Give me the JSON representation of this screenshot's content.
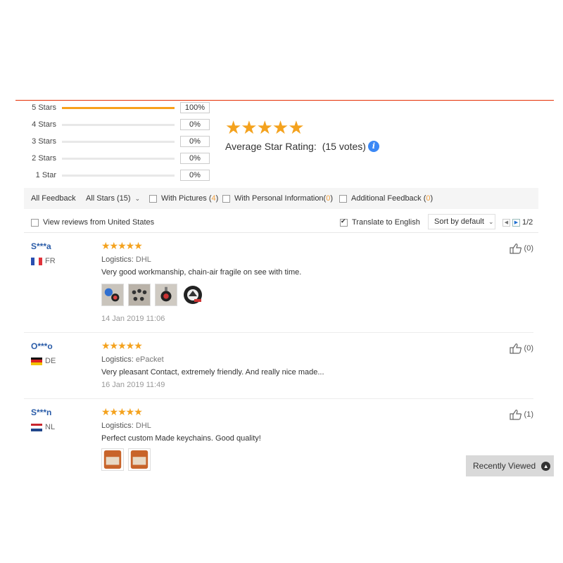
{
  "histogram": [
    {
      "label": "5 Stars",
      "percent": "100%",
      "fill": 1.0
    },
    {
      "label": "4 Stars",
      "percent": "0%",
      "fill": 0
    },
    {
      "label": "3 Stars",
      "percent": "0%",
      "fill": 0
    },
    {
      "label": "2 Stars",
      "percent": "0%",
      "fill": 0
    },
    {
      "label": "1 Star",
      "percent": "0%",
      "fill": 0
    }
  ],
  "summary": {
    "stars": "★★★★★",
    "rating_label": "Average Star Rating:",
    "votes": "(15 votes)",
    "info": "i"
  },
  "filters": {
    "all_feedback": "All Feedback",
    "all_stars": "All Stars (15)",
    "with_pictures_label": "With Pictures (",
    "with_pictures_count": "4",
    "personal_info_label": "With Personal Information(",
    "personal_info_count": "0",
    "additional_label": "Additional Feedback (",
    "additional_count": "0",
    "close_paren": ")"
  },
  "subbar": {
    "view_us": "View reviews from United States",
    "translate": "Translate to English",
    "sort": "Sort by default",
    "page": "1/2"
  },
  "reviews": [
    {
      "user": "S***a",
      "country": "FR",
      "stars": "★★★★★",
      "logistics_label": "Logistics:",
      "logistics": "DHL",
      "text": "Very good workmanship, chain-air fragile on see with time.",
      "date": "14 Jan 2019 11:06",
      "helpful": "(0)"
    },
    {
      "user": "O***o",
      "country": "DE",
      "stars": "★★★★★",
      "logistics_label": "Logistics:",
      "logistics": "ePacket",
      "text": "Very pleasant Contact, extremely friendly. And really nice made...",
      "date": "16 Jan 2019 11:49",
      "helpful": "(0)"
    },
    {
      "user": "S***n",
      "country": "NL",
      "stars": "★★★★★",
      "logistics_label": "Logistics:",
      "logistics": "DHL",
      "text": "Perfect custom Made keychains. Good quality!",
      "helpful": "(1)"
    }
  ],
  "recently_viewed": "Recently Viewed",
  "colors": {
    "accent_red": "#e62e04",
    "star_orange": "#f4a21e",
    "username_blue": "#2a5ca8",
    "info_blue": "#3b88f5"
  }
}
